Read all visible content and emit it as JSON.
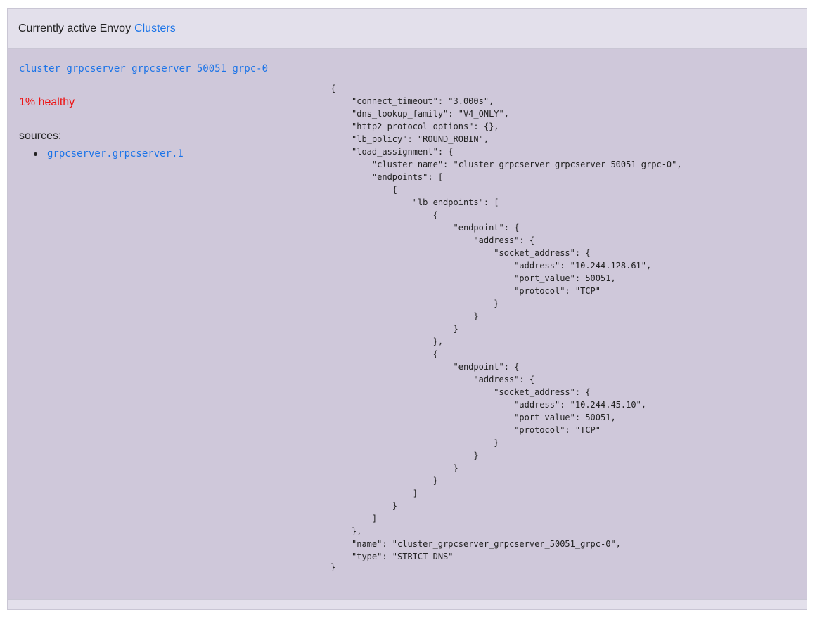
{
  "header": {
    "prefix": "Currently active Envoy",
    "link": "Clusters"
  },
  "cluster": {
    "name": "cluster_grpcserver_grpcserver_50051_grpc-0",
    "health": "1% healthy",
    "sources_label": "sources:",
    "sources": [
      "grpcserver.grpcserver.1"
    ]
  },
  "config": {
    "open_brace": "{",
    "close_brace": "}",
    "lines": [
      "\"connect_timeout\": \"3.000s\",",
      "\"dns_lookup_family\": \"V4_ONLY\",",
      "\"http2_protocol_options\": {},",
      "\"lb_policy\": \"ROUND_ROBIN\",",
      "\"load_assignment\": {",
      "    \"cluster_name\": \"cluster_grpcserver_grpcserver_50051_grpc-0\",",
      "    \"endpoints\": [",
      "        {",
      "            \"lb_endpoints\": [",
      "                {",
      "                    \"endpoint\": {",
      "                        \"address\": {",
      "                            \"socket_address\": {",
      "                                \"address\": \"10.244.128.61\",",
      "                                \"port_value\": 50051,",
      "                                \"protocol\": \"TCP\"",
      "                            }",
      "                        }",
      "                    }",
      "                },",
      "                {",
      "                    \"endpoint\": {",
      "                        \"address\": {",
      "                            \"socket_address\": {",
      "                                \"address\": \"10.244.45.10\",",
      "                                \"port_value\": 50051,",
      "                                \"protocol\": \"TCP\"",
      "                            }",
      "                        }",
      "                    }",
      "                }",
      "            ]",
      "        }",
      "    ]",
      "},",
      "\"name\": \"cluster_grpcserver_grpcserver_50051_grpc-0\",",
      "\"type\": \"STRICT_DNS\""
    ]
  }
}
